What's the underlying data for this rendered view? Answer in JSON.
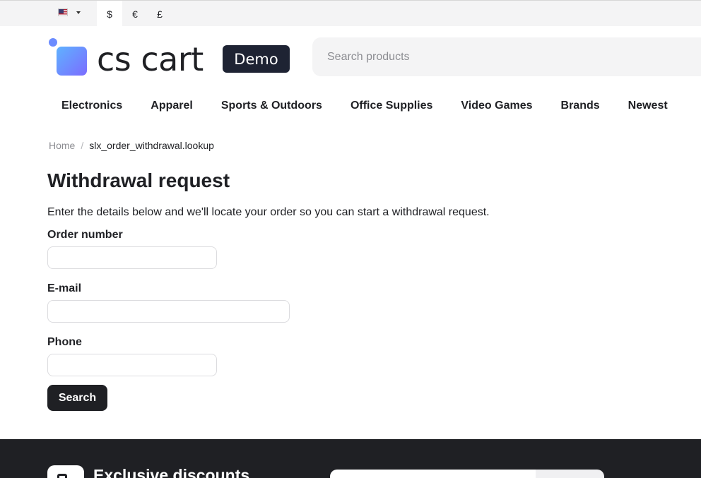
{
  "topbar": {
    "language_icon": "us-flag-icon",
    "currencies": [
      {
        "symbol": "$",
        "active": true
      },
      {
        "symbol": "€",
        "active": false
      },
      {
        "symbol": "£",
        "active": false
      }
    ]
  },
  "header": {
    "logo_text": "cs cart",
    "logo_badge": "Demo",
    "search_placeholder": "Search products"
  },
  "nav": {
    "items": [
      "Electronics",
      "Apparel",
      "Sports & Outdoors",
      "Office Supplies",
      "Video Games",
      "Brands",
      "Newest"
    ]
  },
  "breadcrumb": {
    "home": "Home",
    "separator": "/",
    "current": "slx_order_withdrawal.lookup"
  },
  "main": {
    "title": "Withdrawal request",
    "intro": "Enter the details below and we'll locate your order so you can start a withdrawal request.",
    "order_label": "Order number",
    "order_value": "",
    "email_label": "E-mail",
    "email_value": "",
    "phone_label": "Phone",
    "phone_value": "",
    "search_button": "Search"
  },
  "footer": {
    "title": "Exclusive discounts"
  },
  "colors": {
    "brand_dark": "#1f2024",
    "badge_bg": "#1e2333",
    "logo_gradient_start": "#5fb2ff",
    "logo_gradient_end": "#7b6cff",
    "topbar_bg": "#f4f4f5"
  }
}
